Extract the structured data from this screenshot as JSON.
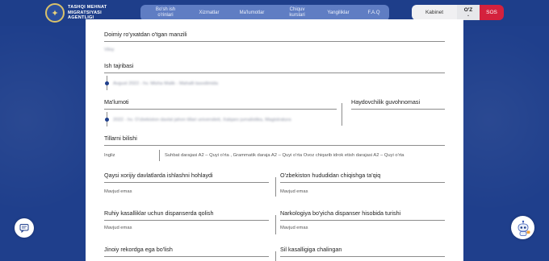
{
  "header": {
    "logo_lines": [
      "TASHQI MEHNAT",
      "MIGRATSIYASI",
      "AGENTLIGI"
    ],
    "nav": [
      {
        "label_lines": [
          "Bo'sh ish",
          "o'rinlari"
        ]
      },
      {
        "label_lines": [
          "Xizmatlar"
        ]
      },
      {
        "label_lines": [
          "Ma'lumotlar"
        ]
      },
      {
        "label_lines": [
          "Chiquv",
          "kurslari"
        ]
      },
      {
        "label_lines": [
          "Yangiliklar"
        ]
      },
      {
        "label_lines": [
          "F.A.Q"
        ]
      }
    ],
    "kabinet_label": "Kabinet",
    "lang_label": "O'Z",
    "lang_chevron": "⌄",
    "sos_label": "SOS"
  },
  "colors": {
    "header_bg": "#1e3e8a",
    "nav_bg": "#5f7dc3",
    "sos_bg": "#d4213d",
    "accent": "#1f3f8c"
  },
  "form": {
    "address": {
      "label": "Doimiy ro'yxatdan o'tgan manzili",
      "value": "Viloy"
    },
    "experience": {
      "label": "Ish tajribasi",
      "value": "Avgust 2022 - hv. Misha Malik - Mahalli tasodimida"
    },
    "education": {
      "label": "Ma'lumoti",
      "value": "2022 - hv. O'zbekiston davlat jahon tillari universiteti, Xalqaro jurnalistika, Magistratura"
    },
    "license": {
      "label": "Haydovchilik guvohnomasi"
    },
    "languages": {
      "label": "Tillarni bilishi",
      "language": "Ingliz",
      "levels": "Suhbat darajasi A2 – Quyi o'rta , Grammatik daraja A2 – Quyi o'rta Ovoz chiqarib idrok etish darajasi A2 – Quyi o'rta"
    },
    "foreign_debt": {
      "label": "Qaysi xorijiy davlatlarda ishlashni hohlaydi",
      "value": "Mavjud emas"
    },
    "exit_ban": {
      "label": "O'zbekiston hududidan chiqishga ta'qiq",
      "value": "Mavjud emas"
    },
    "mental_dispanser": {
      "label": "Ruhiy kasalliklar uchun dispanserda qolish",
      "value": "Mavjud emas"
    },
    "narco_dispanser": {
      "label": "Narkologiya bo'yicha dispanser hisobida turishi",
      "value": "Mavjud emas"
    },
    "criminal": {
      "label": "Jinoiy rekordga ega bo'lish"
    },
    "tb": {
      "label": "Sil kasalligiga chalingan"
    }
  },
  "floating": {
    "chat_icon": "chat-icon",
    "bot_icon": "robot-icon"
  }
}
